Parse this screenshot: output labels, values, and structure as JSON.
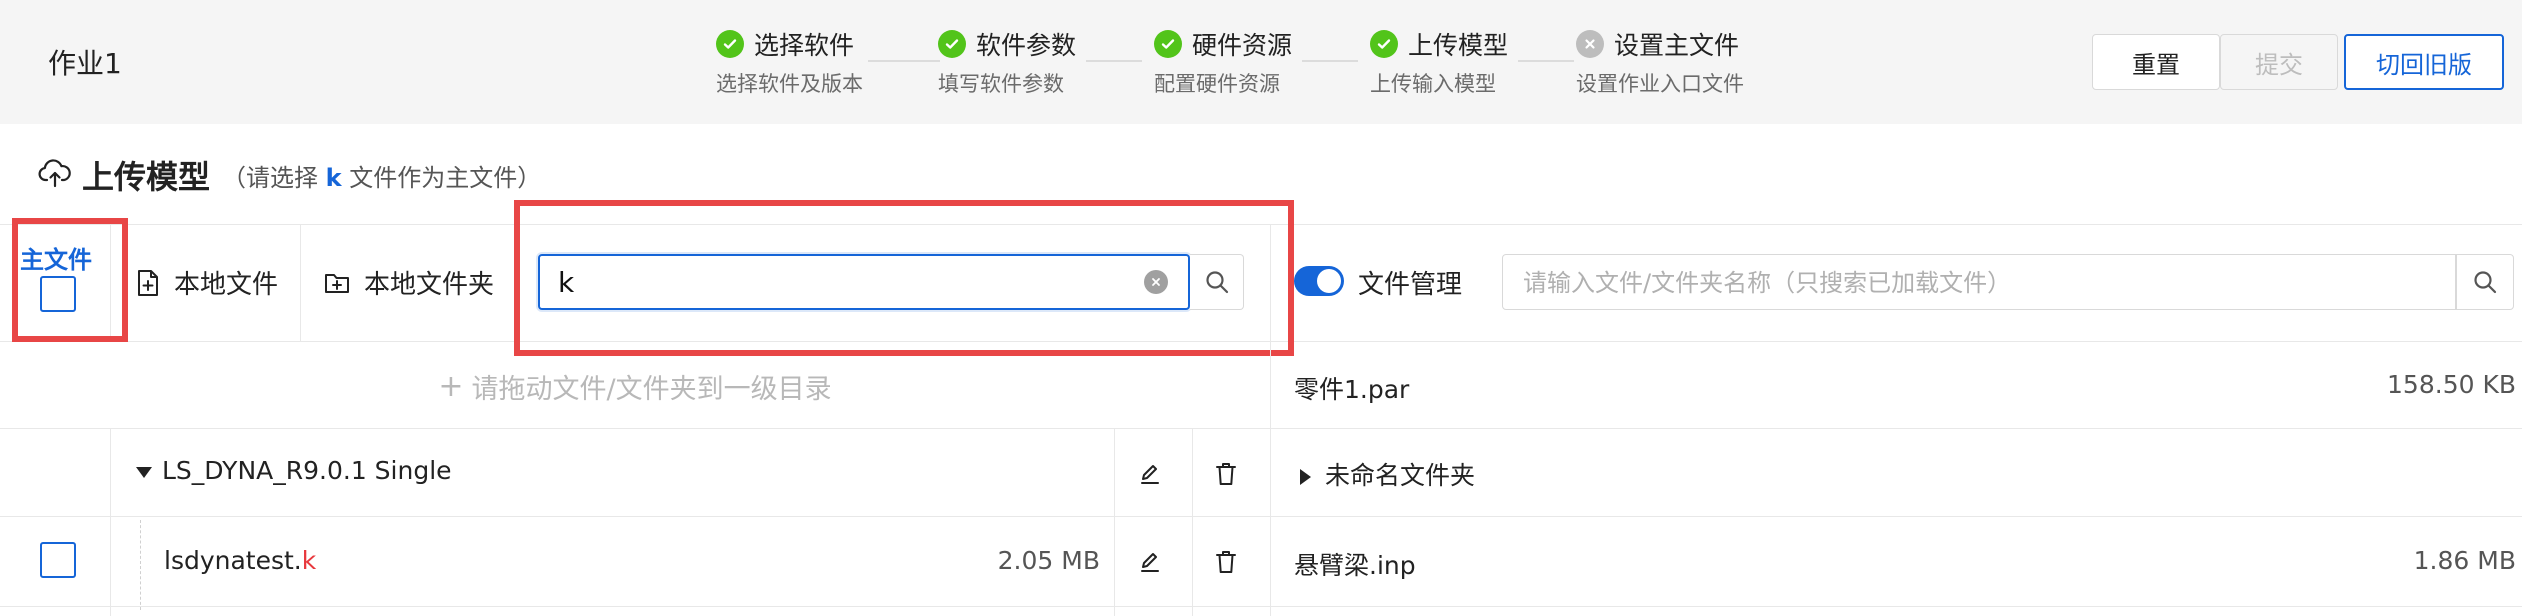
{
  "header": {
    "job_title": "作业1",
    "steps": [
      {
        "title": "选择软件",
        "desc": "选择软件及版本",
        "status": "done"
      },
      {
        "title": "软件参数",
        "desc": "填写软件参数",
        "status": "done"
      },
      {
        "title": "硬件资源",
        "desc": "配置硬件资源",
        "status": "done"
      },
      {
        "title": "上传模型",
        "desc": "上传输入模型",
        "status": "done"
      },
      {
        "title": "设置主文件",
        "desc": "设置作业入口文件",
        "status": "pending"
      }
    ],
    "buttons": {
      "reset": "重置",
      "submit": "提交",
      "switch_old": "切回旧版"
    }
  },
  "section": {
    "title": "上传模型",
    "hint_prefix": "（请选择",
    "hint_ext": "k",
    "hint_suffix": "文件作为主文件）"
  },
  "toolbar": {
    "main_file_label": "主文件",
    "local_file": "本地文件",
    "local_folder": "本地文件夹",
    "search_value": "k",
    "file_manage_label": "文件管理",
    "file_manage_on": true,
    "right_search_placeholder": "请输入文件/文件夹名称（只搜索已加载文件）"
  },
  "left_tree": {
    "drop_hint": "请拖动文件/文件夹到一级目录",
    "folder": {
      "name": "LS_DYNA_R9.0.1 Single",
      "expanded": true
    },
    "files": [
      {
        "name_base": "lsdynatest.",
        "name_match": "k",
        "size": "2.05 MB"
      }
    ]
  },
  "right_list": {
    "items": [
      {
        "name": "零件1.par",
        "size": "158.50 KB"
      },
      {
        "name": "未命名文件夹",
        "type": "folder"
      },
      {
        "name": "悬臂梁.inp",
        "size": "1.86 MB"
      }
    ]
  },
  "colors": {
    "primary": "#1565d8",
    "success": "#52c41a",
    "highlight": "#e84646",
    "match": "#e8383d"
  }
}
